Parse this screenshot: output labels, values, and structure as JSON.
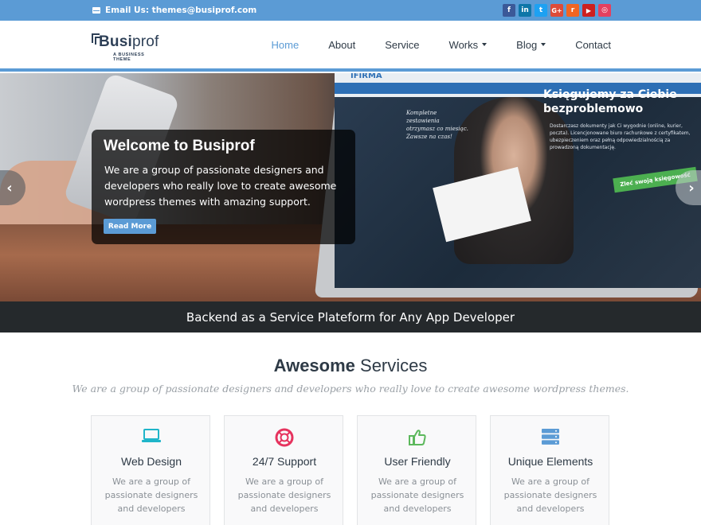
{
  "topbar": {
    "email": "Email Us: themes@busiprof.com",
    "social": [
      {
        "icon": "facebook-icon",
        "glyph": "f",
        "color": "#3b5998"
      },
      {
        "icon": "linkedin-icon",
        "glyph": "in",
        "color": "#0e76a8"
      },
      {
        "icon": "twitter-icon",
        "glyph": "t",
        "color": "#1da1f2"
      },
      {
        "icon": "googleplus-icon",
        "glyph": "G+",
        "color": "#dd4b39"
      },
      {
        "icon": "rss-icon",
        "glyph": "r",
        "color": "#f26522"
      },
      {
        "icon": "youtube-icon",
        "glyph": "▶",
        "color": "#cd201f"
      },
      {
        "icon": "instagram-icon",
        "glyph": "◎",
        "color": "#e4405f"
      }
    ]
  },
  "logo": {
    "name_part1": "Busi",
    "name_part2": "prof",
    "tagline": "A BUSINESS THEME"
  },
  "nav": {
    "items": [
      {
        "label": "Home",
        "active": true
      },
      {
        "label": "About"
      },
      {
        "label": "Service"
      },
      {
        "label": "Works",
        "dropdown": true
      },
      {
        "label": "Blog",
        "dropdown": true
      },
      {
        "label": "Contact"
      }
    ]
  },
  "hero": {
    "title": "Welcome to Busiprof",
    "text": "We are a group of passionate designers and developers who really love to create awesome wordpress themes with amazing support.",
    "button": "Read More",
    "screen_brand": "IFIRMA",
    "screen_headline": "Księgujemy za Ciebie bezproblemowo",
    "screen_note": "Kompletne zestawienia otrzymasz co miesiąc. Zawsze na czas!",
    "screen_bullets": "Dostarczasz dokumenty jak Ci wygodnie (online, kurier, poczta). Licencjonowane biuro rachunkowe z certyfikatem, ubezpieczeniem oraz pełną odpowiedzialnością za prowadzoną dokumentację.",
    "screen_cta": "Zleć swoją księgowość"
  },
  "strip": {
    "text": "Backend as a Service Plateform for Any App Developer"
  },
  "services": {
    "title_bold": "Awesome",
    "title_rest": " Services",
    "subtitle": "We are a group of passionate designers and developers who really love to create awesome wordpress themes.",
    "cards": [
      {
        "icon": "laptop-icon",
        "title": "Web Design",
        "text": "We are a group of passionate designers and developers",
        "color": "#1fb5c9"
      },
      {
        "icon": "lifebuoy-icon",
        "title": "24/7 Support",
        "text": "We are a group of passionate designers and developers",
        "color": "#e6335e"
      },
      {
        "icon": "thumbs-up-icon",
        "title": "User Friendly",
        "text": "We are a group of passionate designers and developers",
        "color": "#5cb85c"
      },
      {
        "icon": "server-icon",
        "title": "Unique Elements",
        "text": "We are a group of passionate designers and developers",
        "color": "#5b9bd5"
      }
    ]
  }
}
